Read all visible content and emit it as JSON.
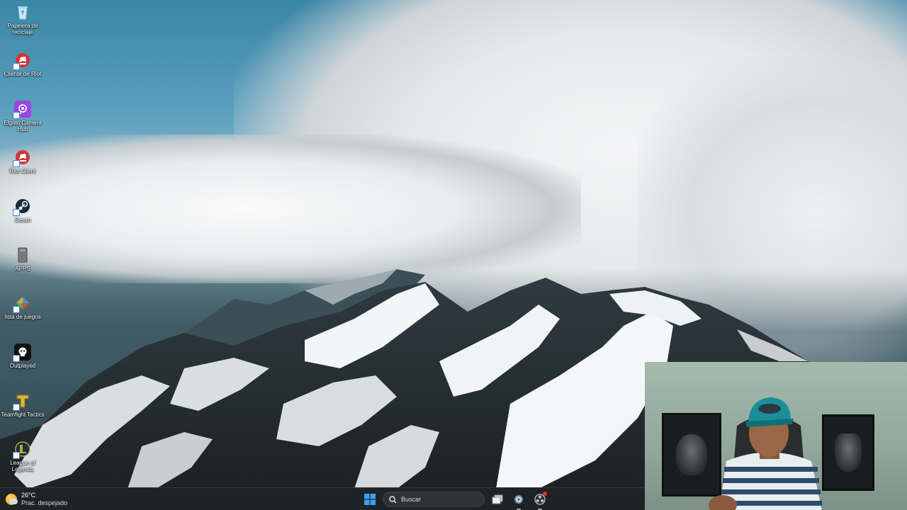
{
  "desktop": {
    "icons": [
      {
        "label": "Papelera de reciclaje",
        "icon": "recycle-bin-icon",
        "color": "#8fc9ea"
      },
      {
        "label": "Cliente de Riot",
        "icon": "riot-client-icon",
        "color": "#d13639"
      },
      {
        "label": "Elgato Camera Hub",
        "icon": "elgato-camera-hub-icon",
        "color": "#9b45e0"
      },
      {
        "label": "Riot Client",
        "icon": "riot-client-icon",
        "color": "#d13639"
      },
      {
        "label": "Steam",
        "icon": "steam-icon",
        "color": "#1b2838"
      },
      {
        "label": "APPS",
        "icon": "folder-icon",
        "color": "#6d6d6d"
      },
      {
        "label": "lista de juegos",
        "icon": "game-list-icon",
        "color": "#e8a23a"
      },
      {
        "label": "Outplayed",
        "icon": "outplayed-icon",
        "color": "#111111"
      },
      {
        "label": "Teamfight Tactics",
        "icon": "teamfight-tactics-icon",
        "color": "#e0b43c"
      },
      {
        "label": "League of Legends",
        "icon": "league-of-legends-icon",
        "color": "#c8a24a"
      }
    ]
  },
  "taskbar": {
    "weather": {
      "temp": "26°C",
      "condition": "Prac. despejado"
    },
    "search": {
      "placeholder": "Buscar"
    },
    "apps": [
      {
        "name": "task-view",
        "icon": "task-view-icon"
      },
      {
        "name": "settings",
        "icon": "gear-icon"
      },
      {
        "name": "obs-recorder",
        "icon": "obs-icon",
        "badge": true
      }
    ],
    "accent": "#3ba0f0"
  },
  "webcam": {
    "visible": true
  }
}
